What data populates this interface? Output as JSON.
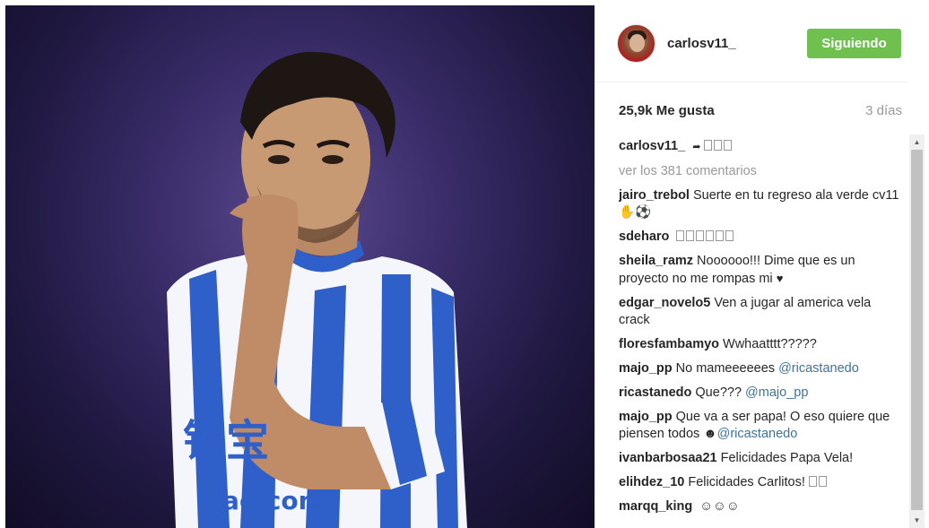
{
  "photo": {
    "watermark_chars": "钱宝",
    "watermark_url": "bao.com"
  },
  "header": {
    "username": "carlosv11_",
    "follow_label": "Siguiendo"
  },
  "stats": {
    "likes": "25,9k Me gusta",
    "time": "3 días"
  },
  "caption": {
    "user": "carlosv11_",
    "text": ""
  },
  "load_more": "ver los 381 comentarios",
  "comments": [
    {
      "user": "jairo_trebol",
      "text": "Suerte en tu regreso ala verde cv11",
      "mention": ""
    },
    {
      "user": "sdeharo",
      "text": "",
      "mention": ""
    },
    {
      "user": "sheila_ramz",
      "text": "Noooooo!!! Dime que es un proyecto no me rompas mi",
      "mention": ""
    },
    {
      "user": "edgar_novelo5",
      "text": "Ven a jugar al america vela crack",
      "mention": ""
    },
    {
      "user": "floresfambamyo",
      "text": "Wwhaatttt?????",
      "mention": ""
    },
    {
      "user": "majo_pp",
      "text": "No mameeeeees",
      "mention": "@ricastanedo"
    },
    {
      "user": "ricastanedo",
      "text": "Que???",
      "mention": "@majo_pp"
    },
    {
      "user": "majo_pp",
      "text": "Que va a ser papa! O eso quiere que piensen todos",
      "mention": "@ricastanedo"
    },
    {
      "user": "ivanbarbosaa21",
      "text": "Felicidades Papa Vela!",
      "mention": ""
    },
    {
      "user": "elihdez_10",
      "text": "Felicidades Carlitos!",
      "mention": ""
    },
    {
      "user": "marqq_king",
      "text": "",
      "mention": ""
    }
  ],
  "colors": {
    "follow": "#70c050",
    "mention": "#3f729b",
    "muted": "#999999",
    "kit_blue": "#2f5fc8"
  }
}
